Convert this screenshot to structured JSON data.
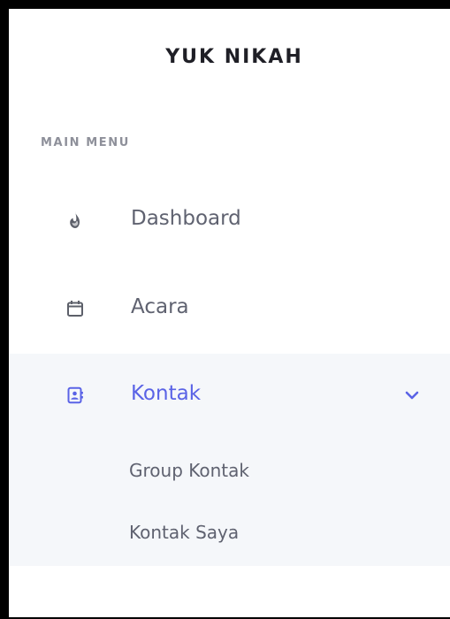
{
  "brand": {
    "title": "YUK NIKAH"
  },
  "menu": {
    "section_label": "MAIN MENU",
    "items": [
      {
        "label": "Dashboard",
        "icon": "fire-icon"
      },
      {
        "label": "Acara",
        "icon": "calendar-icon"
      },
      {
        "label": "Kontak",
        "icon": "contact-book-icon",
        "expanded": true
      }
    ],
    "submenu": [
      {
        "label": "Group Kontak"
      },
      {
        "label": "Kontak Saya"
      }
    ]
  },
  "colors": {
    "accent": "#5a63e6",
    "text": "#5f6270",
    "section": "#8e909a",
    "active_bg": "#f5f7fa"
  }
}
